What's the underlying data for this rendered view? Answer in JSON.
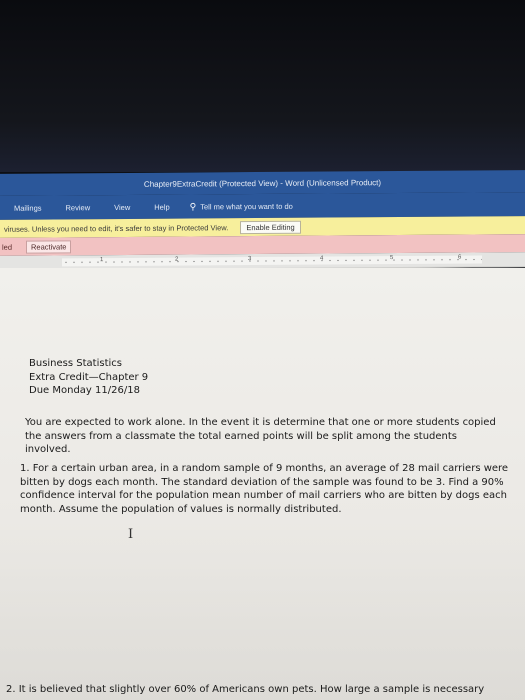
{
  "window": {
    "title": "Chapter9ExtraCredit (Protected View)  -  Word (Unlicensed Product)"
  },
  "ribbon": {
    "tabs": [
      "Mailings",
      "Review",
      "View",
      "Help"
    ],
    "tell_me": "Tell me what you want to do"
  },
  "protected_view": {
    "message": "viruses. Unless you need to edit, it's safer to stay in Protected View.",
    "button": "Enable Editing"
  },
  "license_bar": {
    "status": "led",
    "button": "Reactivate"
  },
  "ruler": {
    "numbers": [
      "1",
      "2",
      "3",
      "4",
      "5",
      "6"
    ]
  },
  "document": {
    "header": [
      "Business Statistics",
      "Extra Credit—Chapter 9",
      "Due Monday 11/26/18"
    ],
    "intro": "You are expected to work alone.  In the event it is determine that one or more students copied the answers from a classmate the total earned points will be split among the students involved.",
    "question1": "1.  For a certain urban area, in a random sample of 9 months, an average of 28 mail carriers were bitten by dogs each month. The standard deviation of the sample was found to be 3.  Find a 90% confidence interval for the population mean number of mail carriers who are bitten by dogs each month.  Assume the population of values is normally distributed.",
    "question2": "2.  It is believed that slightly over 60% of Americans own pets.  How large a sample is necessary"
  }
}
